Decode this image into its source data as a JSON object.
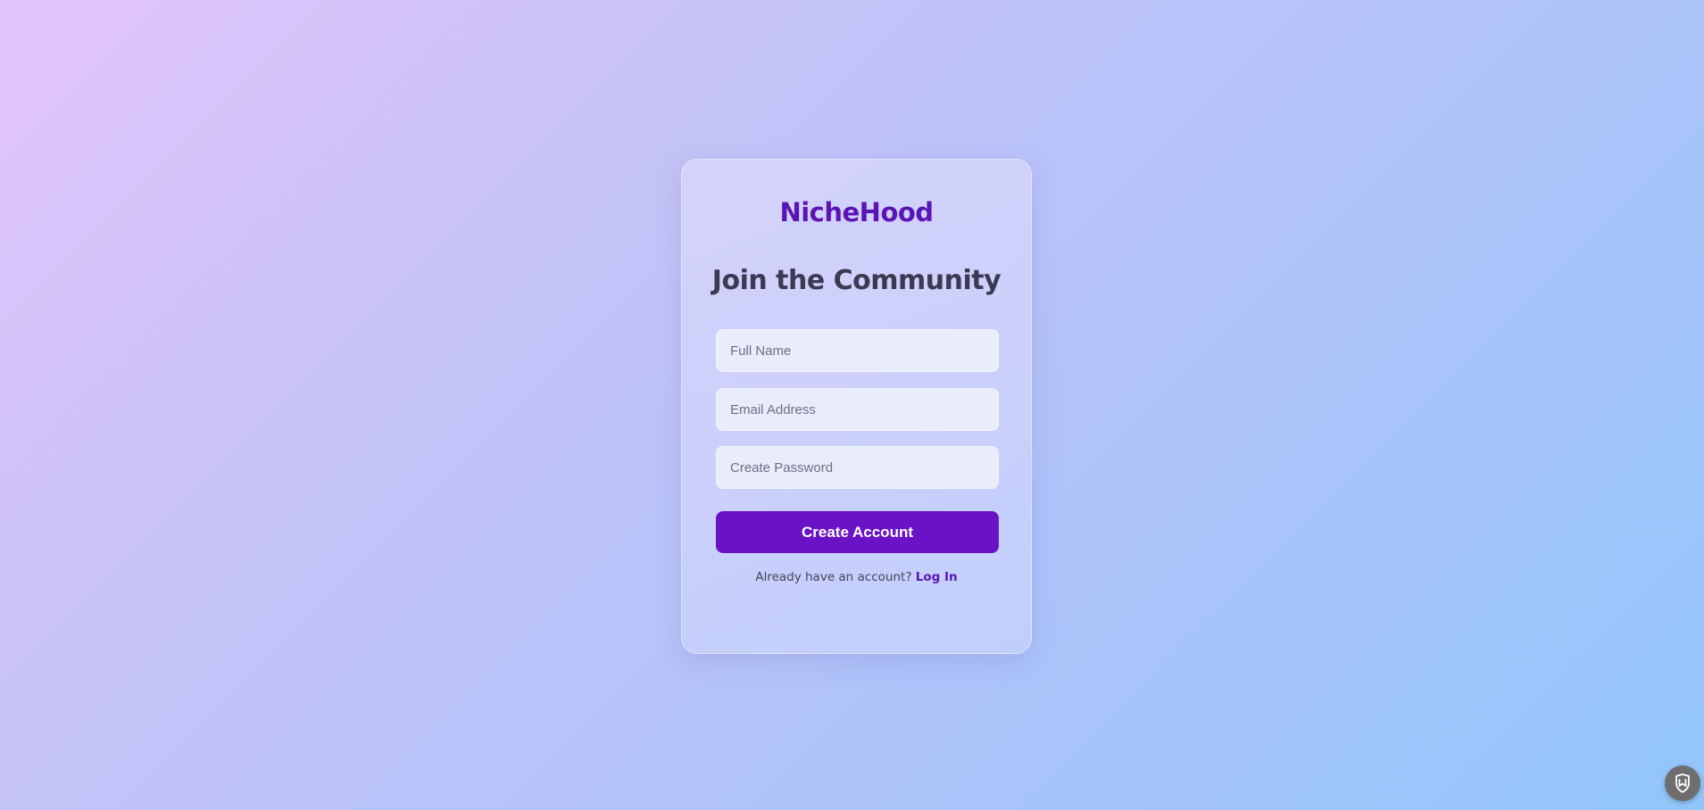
{
  "brand": {
    "name": "NicheHood",
    "color": "#5b14b4"
  },
  "signup": {
    "heading": "Join the Community",
    "full_name_placeholder": "Full Name",
    "email_placeholder": "Email Address",
    "password_placeholder": "Create Password",
    "submit_label": "Create Account",
    "login_prompt": "Already have an account?",
    "login_link": "Log In"
  },
  "colors": {
    "accent": "#6a12c6",
    "heading_text": "#3c3a52"
  },
  "corner_badge": {
    "icon": "shield-logo-icon"
  }
}
